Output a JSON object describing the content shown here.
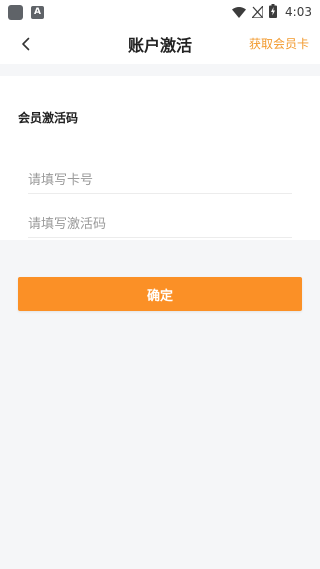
{
  "status_bar": {
    "time": "4:03",
    "notification_glyph": "A",
    "icons": [
      "app-icon",
      "notification-icon",
      "wifi-icon",
      "no-signal-icon",
      "battery-charging-icon"
    ]
  },
  "nav": {
    "title": "账户激活",
    "action_label": "获取会员卡",
    "back_icon": "chevron-left-icon"
  },
  "form": {
    "section_title": "会员激活码",
    "card_number": {
      "value": "",
      "placeholder": "请填写卡号"
    },
    "activation_code": {
      "value": "",
      "placeholder": "请填写激活码"
    }
  },
  "confirm_label": "确定",
  "colors": {
    "accent": "#fb9026",
    "action_text": "#f29a2e",
    "background": "#f5f6f8",
    "card": "#ffffff"
  }
}
